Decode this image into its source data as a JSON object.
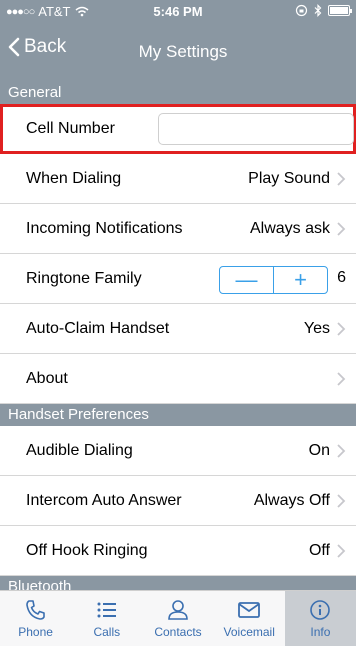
{
  "status": {
    "carrier": "AT&T",
    "time": "5:46 PM"
  },
  "nav": {
    "back_label": "Back",
    "title": "My Settings"
  },
  "sections": {
    "general": "General",
    "handset": "Handset Preferences",
    "bluetooth": "Bluetooth"
  },
  "general_rows": {
    "cell_number": {
      "label": "Cell Number",
      "value": ""
    },
    "when_dialing": {
      "label": "When Dialing",
      "value": "Play Sound"
    },
    "incoming": {
      "label": "Incoming Notifications",
      "value": "Always ask"
    },
    "ringtone": {
      "label": "Ringtone Family",
      "value": "6",
      "minus": "—",
      "plus": "+"
    },
    "auto_claim": {
      "label": "Auto-Claim Handset",
      "value": "Yes"
    },
    "about": {
      "label": "About"
    }
  },
  "handset_rows": {
    "audible": {
      "label": "Audible Dialing",
      "value": "On"
    },
    "intercom": {
      "label": "Intercom Auto Answer",
      "value": "Always Off"
    },
    "offhook": {
      "label": "Off Hook Ringing",
      "value": "Off"
    }
  },
  "tabs": [
    {
      "label": "Phone",
      "icon": "phone-icon"
    },
    {
      "label": "Calls",
      "icon": "list-icon"
    },
    {
      "label": "Contacts",
      "icon": "person-icon"
    },
    {
      "label": "Voicemail",
      "icon": "envelope-icon"
    },
    {
      "label": "Info",
      "icon": "info-icon",
      "active": true
    }
  ],
  "colors": {
    "header": "#8a97a2",
    "accent": "#3aa0e8",
    "tab_icon": "#3b6fb0",
    "highlight": "#e02020"
  }
}
